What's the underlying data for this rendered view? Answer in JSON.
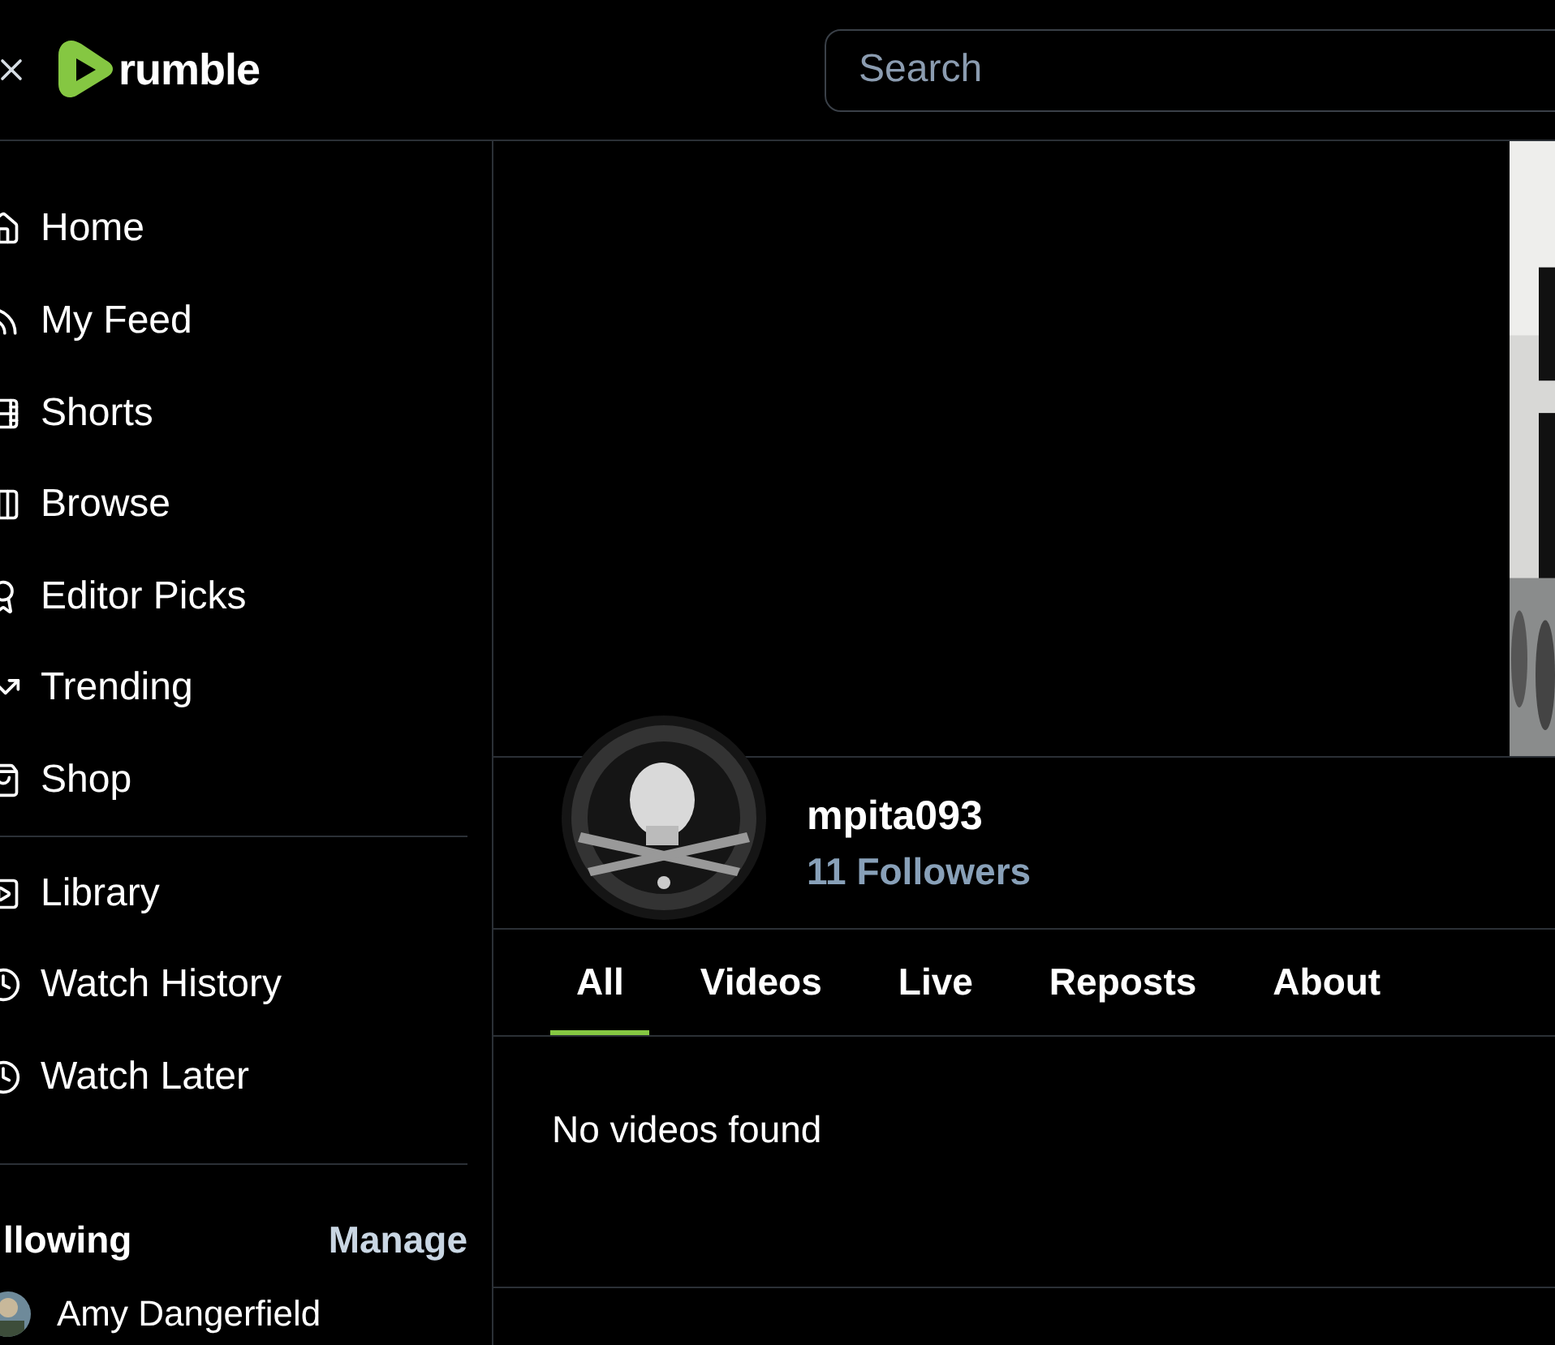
{
  "header": {
    "logo_text": "rumble",
    "search": {
      "placeholder": "Search"
    }
  },
  "sidebar": {
    "sections": [
      {
        "items": [
          {
            "label": "Home",
            "kind": "home"
          },
          {
            "label": "My Feed",
            "kind": "feed"
          },
          {
            "label": "Shorts",
            "kind": "shorts"
          },
          {
            "label": "Browse",
            "kind": "browse"
          },
          {
            "label": "Editor Picks",
            "kind": "award"
          },
          {
            "label": "Trending",
            "kind": "trending"
          },
          {
            "label": "Shop",
            "kind": "shop"
          }
        ]
      },
      {
        "items": [
          {
            "label": "Library",
            "kind": "library"
          },
          {
            "label": "Watch History",
            "kind": "clock"
          },
          {
            "label": "Watch Later",
            "kind": "clock"
          }
        ]
      }
    ],
    "following": {
      "title": "llowing",
      "manage": "Manage",
      "channels": [
        {
          "name": "Amy Dangerfield"
        }
      ]
    }
  },
  "channel": {
    "name": "mpita093",
    "followers": "11 Followers"
  },
  "tabs": [
    {
      "label": "All",
      "selected": true
    },
    {
      "label": "Videos",
      "selected": false
    },
    {
      "label": "Live",
      "selected": false
    },
    {
      "label": "Reposts",
      "selected": false
    },
    {
      "label": "About",
      "selected": false
    }
  ],
  "empty_message": "No videos found"
}
